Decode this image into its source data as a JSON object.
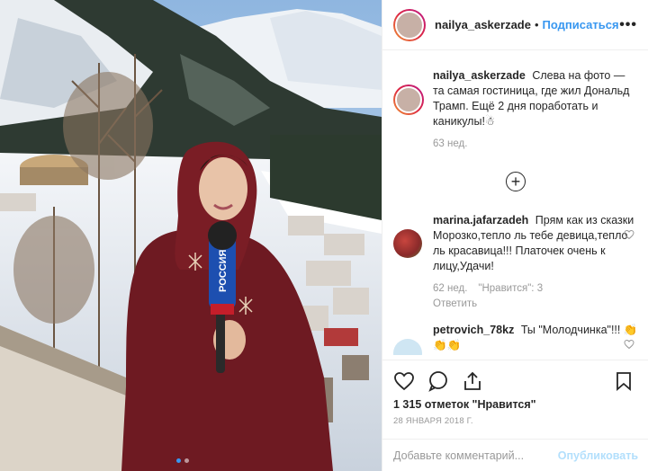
{
  "post": {
    "author": "nailya_askerzade",
    "separator": "•",
    "follow_label": "Подписаться",
    "more_label": "•••"
  },
  "caption": {
    "author": "nailya_askerzade",
    "text": "Слева на фото — та самая гостиница, где жил Дональд Трамп. Ещё 2 дня поработать и каникулы!☃",
    "time": "63 нед."
  },
  "comments": [
    {
      "author": "marina.jafarzadeh",
      "text": "Прям как из сказки Морозко,тепло ль тебе девица,тепло ль красавица!!! Платочек очень к лицу,Удачи!",
      "time": "62 нед.",
      "likes_label": "\"Нравится\": 3",
      "reply_label": "Ответить"
    },
    {
      "author": "petrovich_78kz",
      "text": "Ты \"Молодчинка\"!!! 👏👏👏"
    }
  ],
  "likes": "1 315 отметок \"Нравится\"",
  "date": "28 января 2018 г.",
  "add_comment": {
    "placeholder": "Добавьте комментарий...",
    "publish_label": "Опубликовать"
  },
  "photo": {
    "mic_flag_text": "РОССИЯ",
    "carousel": {
      "count": 2,
      "active": 1
    }
  },
  "colors": {
    "link_blue": "#3897f0",
    "coat": "#6e1a22",
    "sky": "#a8c8e8"
  }
}
